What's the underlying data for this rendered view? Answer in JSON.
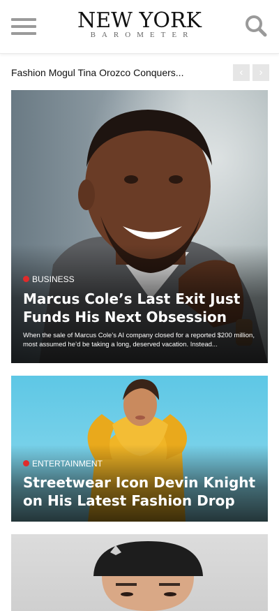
{
  "header": {
    "logo_main": "NEW YORK",
    "logo_sub": "BAROMETER",
    "menu_icon": "hamburger-menu-icon",
    "search_icon": "search-icon"
  },
  "ticker": {
    "headline": "Fashion Mogul Tina Orozco Conquers...",
    "prev": "‹",
    "next": "›"
  },
  "articles": [
    {
      "category": "BUSINESS",
      "category_color": "#e02b2b",
      "title": "Marcus Cole’s Last Exit Just Funds His Next Obsession",
      "excerpt": "When the sale of Marcus Cole’s AI company closed for a reported $200 million, most assumed he’d be taking a long, deserved vacation. Instead..."
    },
    {
      "category": "ENTERTAINMENT",
      "category_color": "#e02b2b",
      "title": "Streetwear Icon Devin Knight on His Latest Fashion Drop",
      "excerpt": ""
    },
    {
      "category": "",
      "title": "",
      "excerpt": ""
    }
  ]
}
